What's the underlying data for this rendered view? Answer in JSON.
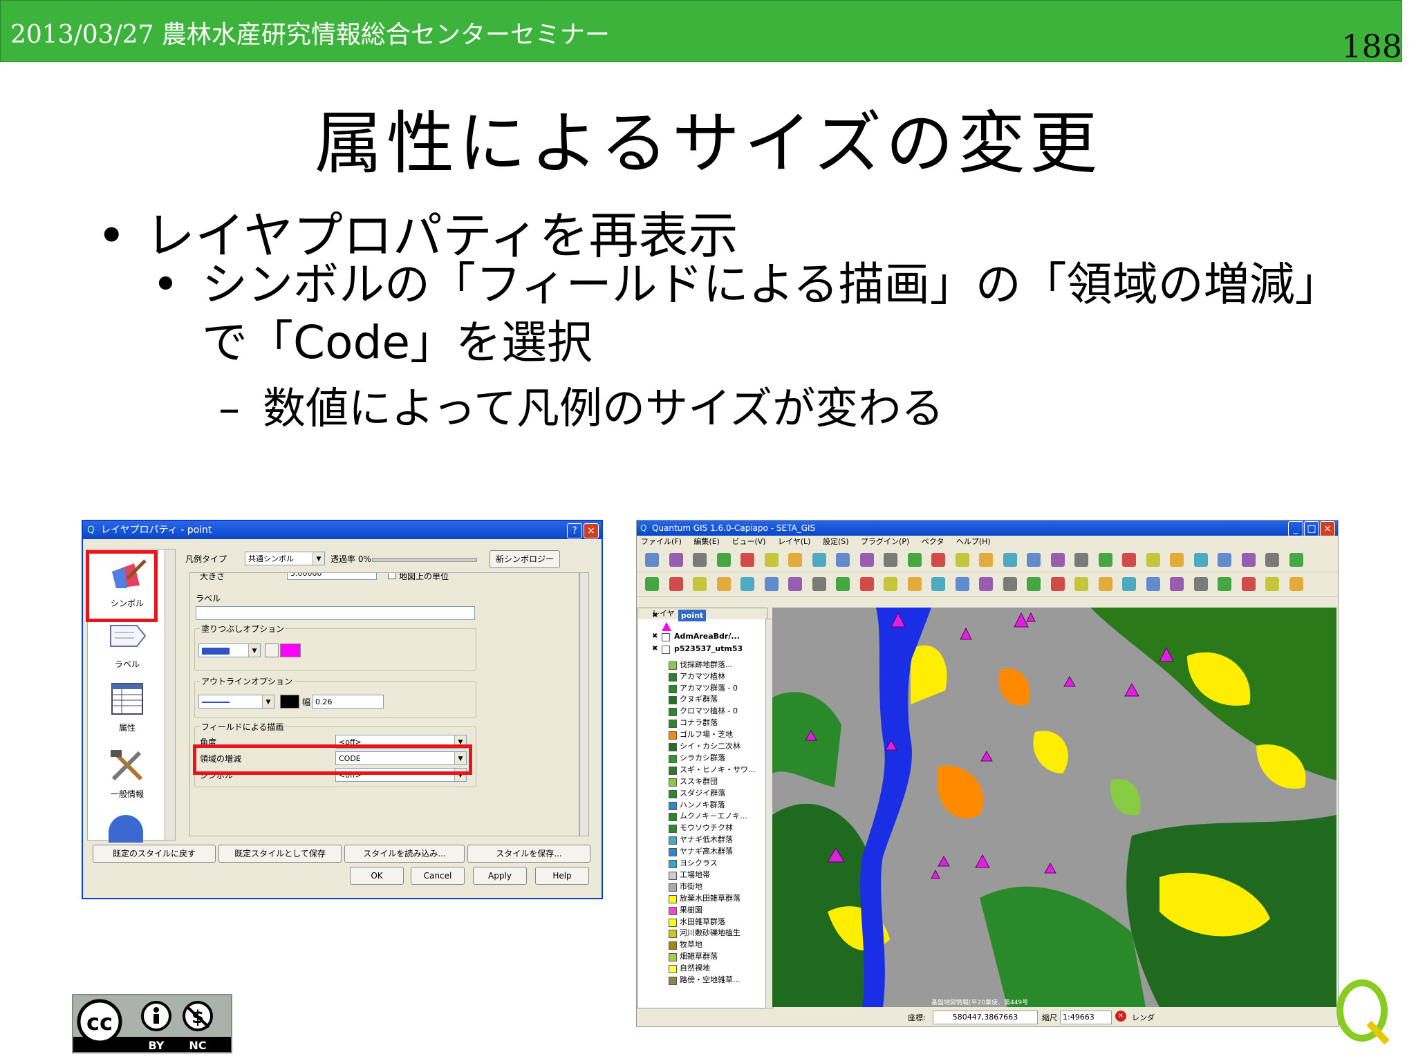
{
  "header": {
    "date_event": "2013/03/27 農林水産研究情報総合センターセミナー",
    "page_number": "188"
  },
  "slide": {
    "title": "属性によるサイズの変更",
    "bullet1": "レイヤプロパティを再表示",
    "bullet2": "シンボルの「フィールドによる描画」の「領域の増減」で「Code」を選択",
    "bullet3": "数値によって凡例のサイズが変わる",
    "bullet_dot": "•",
    "sub_dash": "–"
  },
  "dialog": {
    "title": "レイヤプロパティ - point",
    "sidebar": [
      "シンボル",
      "ラベル",
      "属性",
      "一般情報"
    ],
    "legend_type_label": "凡例タイプ",
    "legend_type_value": "共通シンボル",
    "transparency_label": "透過率 0%",
    "new_symbology_button": "新シンボロジー",
    "size_label": "大きさ",
    "size_value": "5.00000",
    "map_units_label": "地図上の単位",
    "label_label": "ラベル",
    "fill_options_label": "塗りつぶしオプション",
    "outline_options_label": "アウトラインオプション",
    "width_label": "幅",
    "width_value": "0.26",
    "field_draw_label": "フィールドによる描画",
    "angle_label": "角度",
    "angle_value": "<off>",
    "area_scale_label": "領域の増減",
    "area_scale_value": "CODE",
    "symbol_label": "シンボル",
    "symbol_value": "<off>",
    "buttons_row1": [
      "既定のスタイルに戻す",
      "既定スタイルとして保存",
      "スタイルを読み込み...",
      "スタイルを保存..."
    ],
    "buttons_row2": [
      "OK",
      "Cancel",
      "Apply",
      "Help"
    ],
    "colors": {
      "fill": "#3050c8",
      "fill2": "#ff00ff",
      "outline_color": "#000000"
    }
  },
  "qgis": {
    "title": "Quantum GIS 1.6.0-Capiapo - SETA_GIS",
    "menu": [
      "ファイル(F)",
      "編集(E)",
      "ビュー(V)",
      "レイヤ(L)",
      "設定(S)",
      "プラグイン(P)",
      "ベクタ",
      "ヘルプ(H)"
    ],
    "layers_header": "レイヤ",
    "layers": [
      "point",
      "AdmAreaBdr/...",
      "p523537_utm53",
      "伐採跡地群落...",
      "アカマツ植林",
      "アカマツ群落 - 0",
      "クヌギ群落",
      "クロマツ植林 - 0",
      "コナラ群落",
      "ゴルフ場・芝地",
      "シイ・カシ二次林",
      "シラカシ群落",
      "スギ・ヒノキ・サワ...",
      "ススキ群団",
      "スダジイ群落",
      "ハンノキ群落",
      "ムクノキ－エノキ...",
      "モウソウチク林",
      "ヤナギ低木群落",
      "ヤナギ高木群落",
      "ヨシクラス",
      "工場地帯",
      "市街地",
      "放棄水田雑草群落",
      "果樹園",
      "水田雑草群落",
      "河川敷砂礫地植生",
      "牧草地",
      "畑雑草群落",
      "自然裸地",
      "路傍・空地雑草..."
    ],
    "layer_colors": [
      "#ff00ff",
      "#ffffff",
      "#ffffff",
      "#88cc44",
      "#228822",
      "#2a8a2a",
      "#1a7a1a",
      "#2a8a2a",
      "#2a8a2a",
      "#ff8800",
      "#207020",
      "#2a9a2a",
      "#2a7a2a",
      "#88cc44",
      "#2a8a2a",
      "#2a8acc",
      "#2a8a2a",
      "#2a8a2a",
      "#44aacc",
      "#2a8acc",
      "#2aaacc",
      "#cccccc",
      "#aaaaaa",
      "#ffff00",
      "#ff44cc",
      "#ffff00",
      "#cccc00",
      "#aa8800",
      "#aacc44",
      "#ffff44",
      "#888844"
    ],
    "map_credit": "基盤地図情報(平20業使、第449号",
    "status_coord_label": "座標:",
    "status_coord_value": "580447,3867663",
    "status_scale_label": "縮尺",
    "status_scale_value": "1:49663",
    "status_render_label": "レンダ"
  },
  "license": {
    "by": "BY",
    "nc": "NC",
    "cc": "cc"
  }
}
